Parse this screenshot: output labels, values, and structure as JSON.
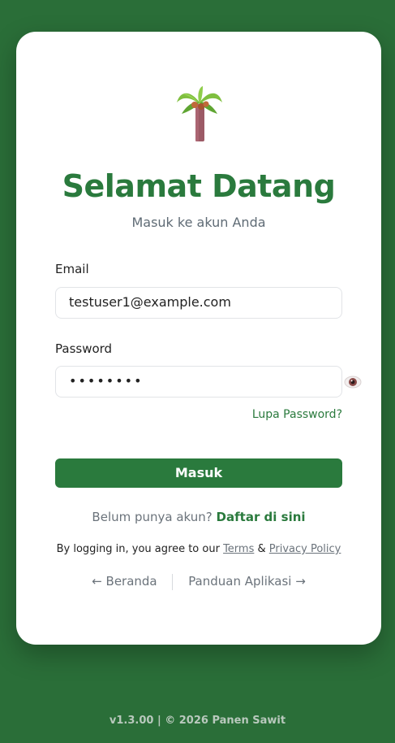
{
  "header": {
    "title": "Selamat Datang",
    "subtitle": "Masuk ke akun Anda",
    "logo_icon": "palm-tree-icon"
  },
  "form": {
    "email_label": "Email",
    "email_value": "testuser1@example.com",
    "password_label": "Password",
    "password_value": "••••••••",
    "toggle_icon": "eye-icon",
    "forgot_label": "Lupa Password?",
    "submit_label": "Masuk"
  },
  "register": {
    "prompt": "Belum punya akun?",
    "link_label": "Daftar di sini"
  },
  "terms": {
    "prefix": "By logging in, you agree to our",
    "terms_label": "Terms",
    "and": "&",
    "privacy_label": "Privacy Policy"
  },
  "nav": {
    "home_label": "← Beranda",
    "guide_label": "Panduan Aplikasi →"
  },
  "footer": {
    "text": "v1.3.00 | © 2026 Panen Sawit"
  },
  "colors": {
    "background": "#2a6e38",
    "accent": "#2a7a3d",
    "card": "#ffffff"
  }
}
